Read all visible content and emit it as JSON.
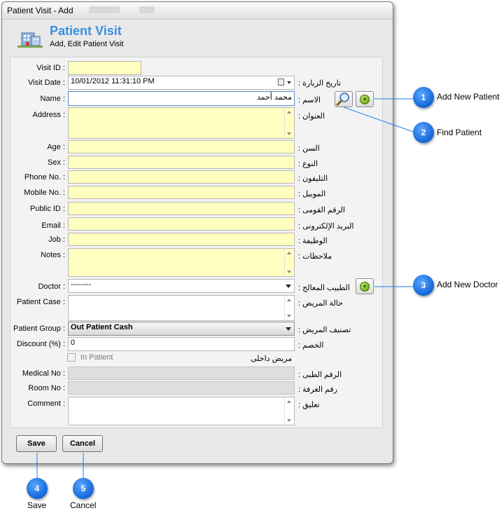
{
  "window": {
    "title": "Patient Visit - Add",
    "header_title": "Patient Visit",
    "header_subtitle": "Add, Edit Patient Visit",
    "header_icon": "hospital-building-icon"
  },
  "fields": {
    "visit_id": {
      "label": "Visit ID :",
      "value": ""
    },
    "visit_date": {
      "label": "Visit Date :",
      "label_ar": "تاريخ الزيارة :",
      "value": "10/01/2012 11:31:10 PM"
    },
    "name": {
      "label": "Name :",
      "label_ar": "الاسم :",
      "value": "محمد أحمد"
    },
    "address": {
      "label": "Address :",
      "label_ar": "العنوان :",
      "value": ""
    },
    "age": {
      "label": "Age :",
      "label_ar": "السن :",
      "value": ""
    },
    "sex": {
      "label": "Sex :",
      "label_ar": "النوع :",
      "value": ""
    },
    "phone": {
      "label": "Phone No. :",
      "label_ar": "التليفون :",
      "value": ""
    },
    "mobile": {
      "label": "Mobile No. :",
      "label_ar": "الموبيل :",
      "value": ""
    },
    "public_id": {
      "label": "Public ID :",
      "label_ar": "الرقم القومى :",
      "value": ""
    },
    "email": {
      "label": "Email :",
      "label_ar": "البريد الإلكترونى :",
      "value": ""
    },
    "job": {
      "label": "Job :",
      "label_ar": "الوظيفة :",
      "value": ""
    },
    "notes": {
      "label": "Notes :",
      "label_ar": "ملاحظات :",
      "value": ""
    },
    "doctor": {
      "label": "Doctor :",
      "label_ar": "الطبيب المعالج :",
      "value": "--------"
    },
    "patient_case": {
      "label": "Patient Case :",
      "label_ar": "حالة المريض :",
      "value": ""
    },
    "patient_group": {
      "label": "Patient Group :",
      "label_ar": "تصنيف المريض :",
      "value": "Out Patient Cash"
    },
    "discount": {
      "label": "Discount (%) :",
      "label_ar": "الخصم :",
      "value": "0"
    },
    "in_patient": {
      "label": "In Patient",
      "label_ar": "مريض داخلى",
      "checked": false
    },
    "medical_no": {
      "label": "Medical No :",
      "label_ar": "الرقم الطبى :",
      "value": ""
    },
    "room_no": {
      "label": "Room No :",
      "label_ar": "رقم الغرفة :",
      "value": ""
    },
    "comment": {
      "label": "Comment :",
      "label_ar": "تعليق :",
      "value": ""
    }
  },
  "buttons": {
    "save": "Save",
    "cancel": "Cancel"
  },
  "callouts": [
    {
      "number": "1",
      "label": "Add New Patient"
    },
    {
      "number": "2",
      "label": "Find Patient"
    },
    {
      "number": "3",
      "label": "Add New Doctor"
    },
    {
      "number": "4",
      "label": "Save"
    },
    {
      "number": "5",
      "label": "Cancel"
    }
  ],
  "colors": {
    "field_bg": "#ffffc0",
    "title_blue": "#3a8fe0",
    "callout_blue": "#1266d8"
  }
}
